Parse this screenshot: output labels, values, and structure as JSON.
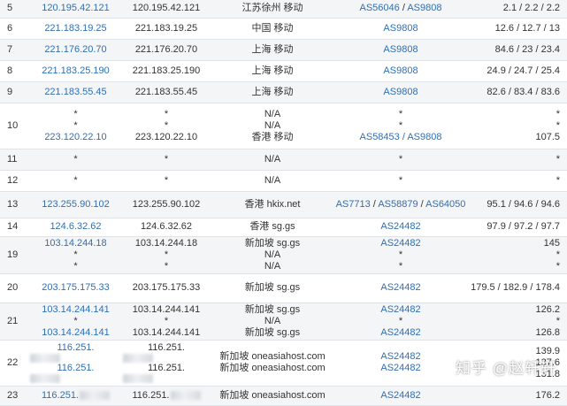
{
  "rows": [
    {
      "hop": "5",
      "ip": "120.195.42.121",
      "host": "120.195.42.121",
      "loc": "江苏徐州 移动",
      "as": [
        "AS56046",
        "AS9808"
      ],
      "lat": "2.1 / 2.2 / 2.2"
    },
    {
      "hop": "6",
      "ip": "221.183.19.25",
      "host": "221.183.19.25",
      "loc": "中国 移动",
      "as": [
        "AS9808"
      ],
      "lat": "12.6 / 12.7 / 13"
    },
    {
      "hop": "7",
      "ip": "221.176.20.70",
      "host": "221.176.20.70",
      "loc": "上海 移动",
      "as": [
        "AS9808"
      ],
      "lat": "84.6 / 23 / 23.4"
    },
    {
      "hop": "8",
      "ip": "221.183.25.190",
      "host": "221.183.25.190",
      "loc": "上海 移动",
      "as": [
        "AS9808"
      ],
      "lat": "24.9 / 24.7 / 25.4"
    },
    {
      "hop": "9",
      "ip": "221.183.55.45",
      "host": "221.183.55.45",
      "loc": "上海 移动",
      "as": [
        "AS9808"
      ],
      "lat": "82.6 / 83.4 / 83.6"
    },
    {
      "hop": "10",
      "ip_lines": [
        "*",
        "*",
        "223.120.22.10"
      ],
      "host_lines": [
        "*",
        "*",
        "223.120.22.10"
      ],
      "loc_lines": [
        "N/A",
        "N/A",
        "香港 移动"
      ],
      "as_lines": [
        "*",
        "*",
        "AS58453 / AS9808"
      ],
      "lat_lines": [
        "*",
        "*",
        "107.5"
      ]
    },
    {
      "hop": "11",
      "ip": "*",
      "host": "*",
      "loc": "N/A",
      "as_text": "*",
      "lat": "*"
    },
    {
      "hop": "12",
      "ip": "*",
      "host": "*",
      "loc": "N/A",
      "as_text": "*",
      "lat": "*"
    },
    {
      "hop": "13",
      "ip": "123.255.90.102",
      "host": "123.255.90.102",
      "loc": "香港 hkix.net",
      "as": [
        "AS7713",
        "AS58879",
        "AS64050"
      ],
      "lat": "95.1 / 94.6 / 94.6"
    },
    {
      "hop": "14",
      "ip": "124.6.32.62",
      "host": "124.6.32.62",
      "loc": "香港 sg.gs",
      "as": [
        "AS24482"
      ],
      "lat": "97.9 / 97.2 / 97.7"
    },
    {
      "hop": "19",
      "ip_lines": [
        "103.14.244.18",
        "*",
        "*"
      ],
      "host_lines": [
        "103.14.244.18",
        "*",
        "*"
      ],
      "loc_lines": [
        "新加坡 sg.gs",
        "N/A",
        "N/A"
      ],
      "as_lines": [
        "AS24482",
        "*",
        "*"
      ],
      "lat_lines": [
        "145",
        "*",
        "*"
      ]
    },
    {
      "hop": "20",
      "ip": "203.175.175.33",
      "host": "203.175.175.33",
      "loc": "新加坡 sg.gs",
      "as": [
        "AS24482"
      ],
      "lat": "179.5 / 182.9 / 178.4"
    },
    {
      "hop": "21",
      "ip_lines": [
        "103.14.244.141",
        "*",
        "103.14.244.141"
      ],
      "host_lines": [
        "103.14.244.141",
        "*",
        "103.14.244.141"
      ],
      "loc_lines": [
        "新加坡 sg.gs",
        "N/A",
        "新加坡 sg.gs"
      ],
      "as_lines": [
        "AS24482",
        "*",
        "AS24482"
      ],
      "lat_lines": [
        "126.2",
        "*",
        "126.8"
      ]
    },
    {
      "hop": "22",
      "ip_lines": [
        "116.251.",
        "116.251."
      ],
      "host_lines": [
        "116.251.",
        "116.251."
      ],
      "loc_lines": [
        "新加坡 oneasiahost.com",
        "新加坡 oneasiahost.com"
      ],
      "as_lines": [
        "AS24482",
        "AS24482"
      ],
      "lat_lines": [
        "139.9",
        "137.6",
        "131.8"
      ]
    },
    {
      "hop": "23",
      "ip": "116.251.",
      "host": "116.251.",
      "loc": "新加坡 oneasiahost.com",
      "as": [
        "AS24482"
      ],
      "lat": "176.2"
    }
  ],
  "watermark": "知乎 @赵轩轩",
  "colors": {
    "link": "#2f6fb3",
    "text": "#333333",
    "rule": "#dfe3e8",
    "shade": "#f4f5f7"
  }
}
